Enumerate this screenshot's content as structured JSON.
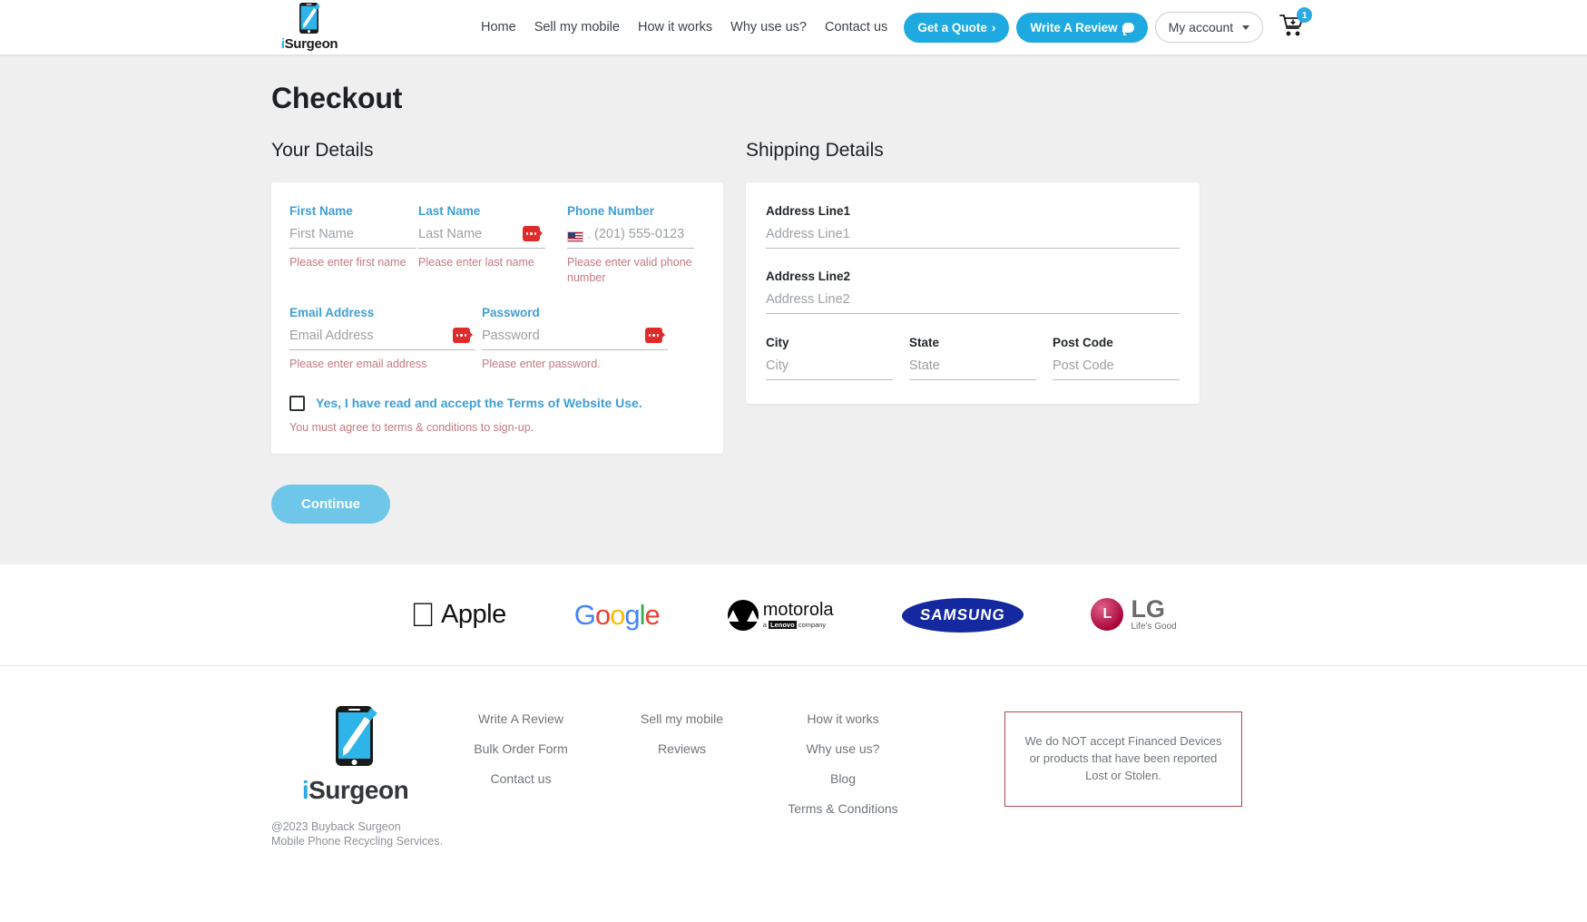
{
  "header": {
    "logo": {
      "i": "i",
      "rest": "Surgeon",
      "name": "iSurgeon"
    },
    "nav": [
      {
        "label": "Home"
      },
      {
        "label": "Sell my mobile"
      },
      {
        "label": "How it works"
      },
      {
        "label": "Why use us?"
      },
      {
        "label": "Contact us"
      }
    ],
    "quote_button": "Get a Quote ",
    "quote_chevron": "›",
    "review_button": "Write A Review",
    "account_button": "My account",
    "cart_count": "1"
  },
  "page": {
    "title": "Checkout"
  },
  "your_details": {
    "section_title": "Your Details",
    "first_name": {
      "label": "First Name",
      "placeholder": "First Name",
      "value": "",
      "error": "Please enter first name"
    },
    "last_name": {
      "label": "Last Name",
      "placeholder": "Last Name",
      "value": "",
      "error": "Please enter last name"
    },
    "phone": {
      "label": "Phone Number",
      "placeholder": "(201) 555-0123",
      "value": "",
      "country_prefix": "·",
      "error": "Please enter valid phone number"
    },
    "email": {
      "label": "Email Address",
      "placeholder": "Email Address",
      "value": "",
      "error": "Please enter email address"
    },
    "password": {
      "label": "Password",
      "placeholder": "Password",
      "value": "",
      "error": "Please enter password."
    },
    "terms": {
      "label": "Yes, I have read and accept the Terms of Website Use.",
      "checked": false,
      "error": "You must agree to terms & conditions to sign-up."
    },
    "continue_button": "Continue"
  },
  "shipping_details": {
    "section_title": "Shipping Details",
    "address1": {
      "label": "Address Line1",
      "placeholder": "Address Line1",
      "value": ""
    },
    "address2": {
      "label": "Address Line2",
      "placeholder": "Address Line2",
      "value": ""
    },
    "city": {
      "label": "City",
      "placeholder": "City",
      "value": ""
    },
    "state": {
      "label": "State",
      "placeholder": "State",
      "value": ""
    },
    "postcode": {
      "label": "Post Code",
      "placeholder": "Post Code",
      "value": ""
    }
  },
  "brands": [
    {
      "name": "Apple",
      "label": "Apple"
    },
    {
      "name": "Google",
      "label": "Google"
    },
    {
      "name": "motorola",
      "label": "motorola",
      "sub_a": "a ",
      "sub_b": "Lenovo",
      "sub_c": " company"
    },
    {
      "name": "SAMSUNG",
      "label": "SAMSUNG"
    },
    {
      "name": "LG",
      "label": "LG",
      "tagline": "Life's Good"
    }
  ],
  "footer": {
    "logo": {
      "i": "i",
      "rest": "Surgeon"
    },
    "copyright_line1": "@2023 Buyback Surgeon",
    "copyright_line2": "Mobile Phone Recycling Services.",
    "col1": [
      {
        "label": "Write A Review"
      },
      {
        "label": "Bulk Order Form"
      },
      {
        "label": "Contact us"
      }
    ],
    "col2": [
      {
        "label": "Sell my mobile"
      },
      {
        "label": "Reviews"
      }
    ],
    "col3": [
      {
        "label": "How it works"
      },
      {
        "label": "Why use us?"
      },
      {
        "label": "Blog"
      },
      {
        "label": "Terms & Conditions"
      }
    ],
    "notice": "We do NOT accept Financed Devices or products that have been reported Lost or Stolen."
  },
  "colors": {
    "brand_blue": "#29abe2",
    "label_blue": "#3e9fd6",
    "error_red": "#c4797f",
    "error_badge": "#e02b2b",
    "page_bg": "#efeff0",
    "continue_blue": "#6ec6e8",
    "notice_border": "#b3494f"
  }
}
